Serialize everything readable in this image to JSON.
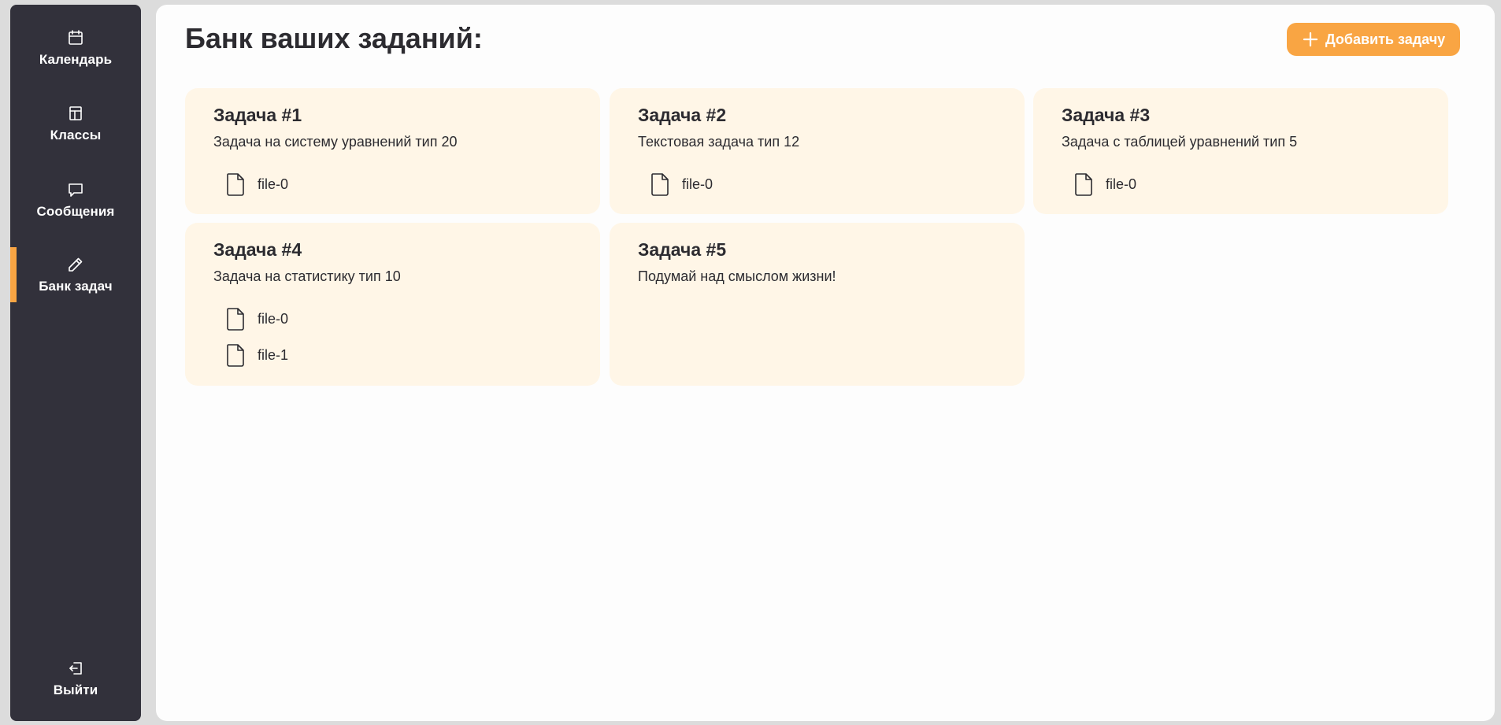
{
  "sidebar": {
    "items": [
      {
        "label": "Календарь",
        "icon": "calendar-icon",
        "active": false
      },
      {
        "label": "Классы",
        "icon": "layout-icon",
        "active": false
      },
      {
        "label": "Сообщения",
        "icon": "message-icon",
        "active": false
      },
      {
        "label": "Банк задач",
        "icon": "pencil-icon",
        "active": true
      }
    ],
    "logout": {
      "label": "Выйти",
      "icon": "logout-icon"
    }
  },
  "main": {
    "title": "Банк ваших заданий:",
    "add_button_label": "Добавить задачу",
    "tasks": [
      {
        "title": "Задача #1",
        "description": "Задача на систему уравнений тип 20",
        "files": [
          "file-0"
        ]
      },
      {
        "title": "Задача #2",
        "description": "Текстовая задача тип 12",
        "files": [
          "file-0"
        ]
      },
      {
        "title": "Задача #3",
        "description": "Задача с таблицей уравнений тип 5",
        "files": [
          "file-0"
        ]
      },
      {
        "title": "Задача #4",
        "description": "Задача на статистику тип 10",
        "files": [
          "file-0",
          "file-1"
        ]
      },
      {
        "title": "Задача #5",
        "description": "Подумай над смыслом жизни!",
        "files": []
      }
    ]
  },
  "colors": {
    "sidebar_bg": "#32313b",
    "accent": "#f9a543",
    "card_bg": "#fff6e7",
    "main_bg": "#fdfdfd",
    "text": "#2c2b30"
  }
}
